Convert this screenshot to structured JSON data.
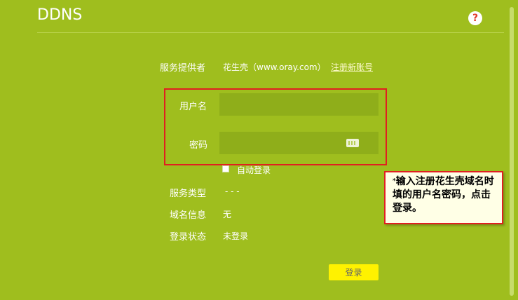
{
  "header": {
    "title": "DDNS",
    "help_icon": "?"
  },
  "form": {
    "provider_label": "服务提供者",
    "provider_value": "花生壳（www.oray.com）",
    "register_link": "注册新账号",
    "username_label": "用户名",
    "username_value": "",
    "password_label": "密码",
    "password_value": "",
    "auto_login_label": "自动登录",
    "auto_login_checked": false,
    "service_type_label": "服务类型",
    "service_type_value": "- - -",
    "domain_info_label": "域名信息",
    "domain_info_value": "无",
    "login_status_label": "登录状态",
    "login_status_value": "未登录",
    "login_button": "登录"
  },
  "annotation": {
    "text": "输入注册花生壳域名时填的用户名密码，点击登录。",
    "marker": "*"
  },
  "colors": {
    "background": "#9fbe1e",
    "input_bg": "#8fae1a",
    "accent_red": "#e02020",
    "button": "#fff200",
    "tooltip_bg": "#ffffe6"
  },
  "icons": [
    "help-icon",
    "keyboard-icon",
    "checkbox-icon"
  ]
}
